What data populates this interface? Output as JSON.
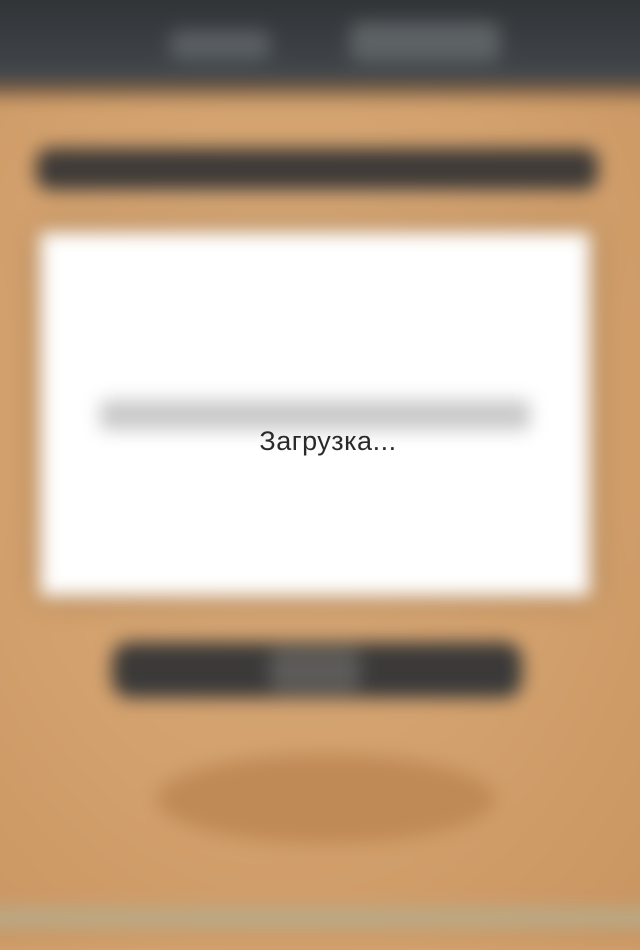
{
  "loading": {
    "text": "Загрузка..."
  },
  "colors": {
    "background": "#d6a673",
    "topbar": "#3a3e42",
    "card": "#ffffff",
    "dark_button": "#3b3a39",
    "text": "#2a2a2a"
  }
}
